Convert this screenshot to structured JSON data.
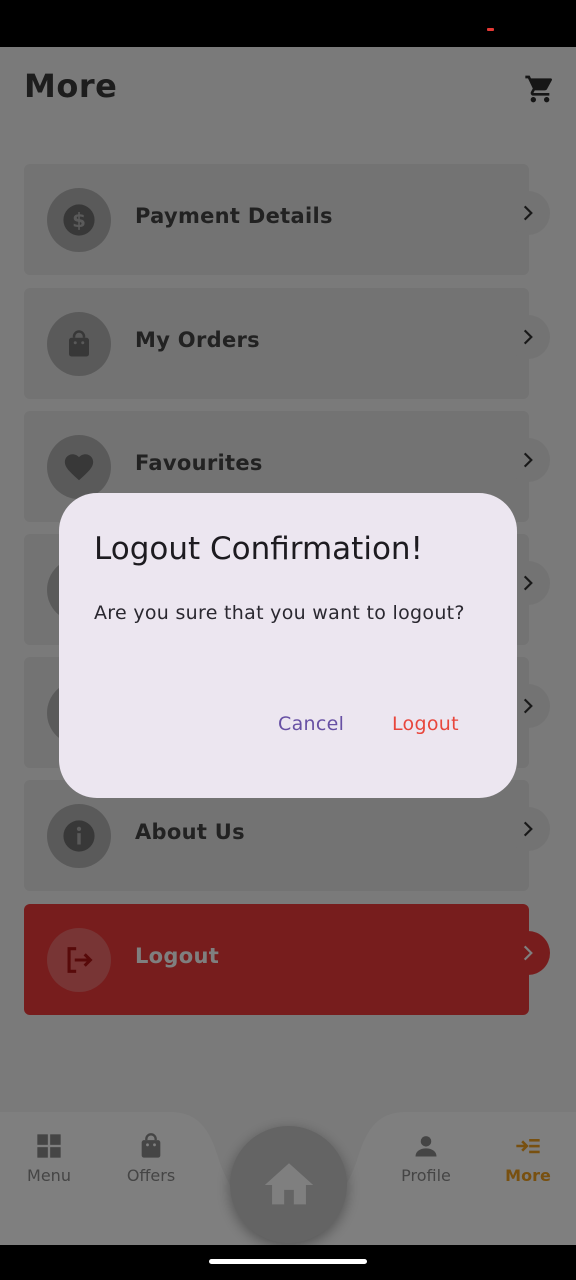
{
  "header": {
    "title": "More",
    "cart_icon": "cart-icon"
  },
  "menu": {
    "items": [
      {
        "label": "Payment Details",
        "icon": "dollar-icon"
      },
      {
        "label": "My Orders",
        "icon": "shopping-bag-icon"
      },
      {
        "label": "Favourites",
        "icon": "heart-icon"
      },
      {
        "label": "",
        "icon": "hidden-icon"
      },
      {
        "label": "",
        "icon": "hidden-icon"
      },
      {
        "label": "About Us",
        "icon": "info-icon"
      },
      {
        "label": "Logout",
        "icon": "logout-icon"
      }
    ]
  },
  "bottom_nav": {
    "items": [
      {
        "label": "Menu",
        "icon": "grid-icon"
      },
      {
        "label": "Offers",
        "icon": "shopping-bag-icon"
      },
      {
        "label": "Profile",
        "icon": "person-icon"
      },
      {
        "label": "More",
        "icon": "menu-arrow-icon",
        "active": true
      }
    ],
    "home_icon": "home-icon"
  },
  "dialog": {
    "title": "Logout Confirmation!",
    "message": "Are you sure that you want to logout?",
    "cancel_label": "Cancel",
    "confirm_label": "Logout"
  },
  "colors": {
    "accent": "#f0a020",
    "logout_red": "#ee3b3b",
    "dialog_bg": "#ece6f0",
    "cancel_purple": "#6750a4",
    "confirm_red": "#e8463c"
  }
}
